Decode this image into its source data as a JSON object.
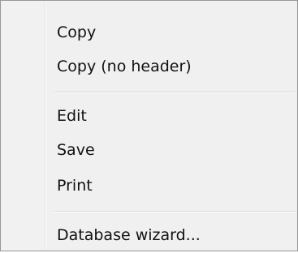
{
  "context_menu": {
    "items": [
      {
        "label": "Copy"
      },
      {
        "label": "Copy (no header)"
      },
      {
        "label": "Edit"
      },
      {
        "label": "Save"
      },
      {
        "label": "Print"
      },
      {
        "label": "Database wizard..."
      }
    ]
  },
  "colors": {
    "menu_background": "#f0f0f0",
    "menu_border": "#979797",
    "separator": "#d9d9d9",
    "text": "#111111"
  }
}
